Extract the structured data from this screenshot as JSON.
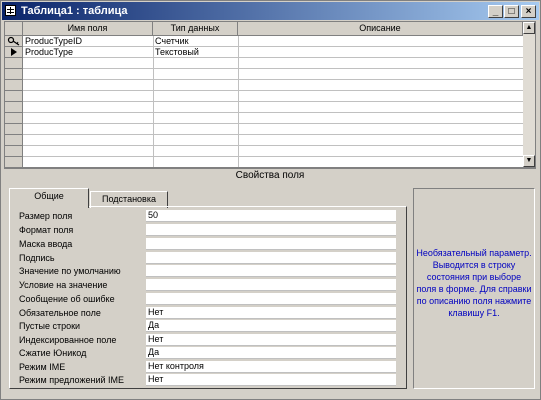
{
  "window": {
    "title": "Таблица1 : таблица",
    "minimize_glyph": "_",
    "maximize_glyph": "□",
    "close_glyph": "×"
  },
  "grid": {
    "columns": [
      "Имя поля",
      "Тип данных",
      "Описание"
    ],
    "rows": [
      {
        "indicator": "key",
        "name": "ProducTypeID",
        "type": "Счетчик",
        "description": ""
      },
      {
        "indicator": "current",
        "name": "ProducType",
        "type": "Текстовый",
        "description": ""
      }
    ],
    "scroll_up_glyph": "▲",
    "scroll_down_glyph": "▼"
  },
  "properties": {
    "header": "Свойства поля",
    "tabs": [
      "Общие",
      "Подстановка"
    ],
    "active_tab": 0,
    "rows": [
      {
        "label": "Размер поля",
        "value": "50"
      },
      {
        "label": "Формат поля",
        "value": ""
      },
      {
        "label": "Маска ввода",
        "value": ""
      },
      {
        "label": "Подпись",
        "value": ""
      },
      {
        "label": "Значение по умолчанию",
        "value": ""
      },
      {
        "label": "Условие на значение",
        "value": ""
      },
      {
        "label": "Сообщение об ошибке",
        "value": ""
      },
      {
        "label": "Обязательное поле",
        "value": "Нет"
      },
      {
        "label": "Пустые строки",
        "value": "Да"
      },
      {
        "label": "Индексированное поле",
        "value": "Нет"
      },
      {
        "label": "Сжатие Юникод",
        "value": "Да"
      },
      {
        "label": "Режим IME",
        "value": "Нет контроля"
      },
      {
        "label": "Режим предложений IME",
        "value": "Нет"
      }
    ],
    "hint": "Необязательный параметр. Выводится в строку состояния при выборе поля в форме. Для справки по описанию поля нажмите клавишу F1."
  },
  "icons": {
    "title_icon": "table-icon",
    "key_indicator": "primary-key-icon",
    "current_row_indicator": "current-row-arrow-icon"
  }
}
